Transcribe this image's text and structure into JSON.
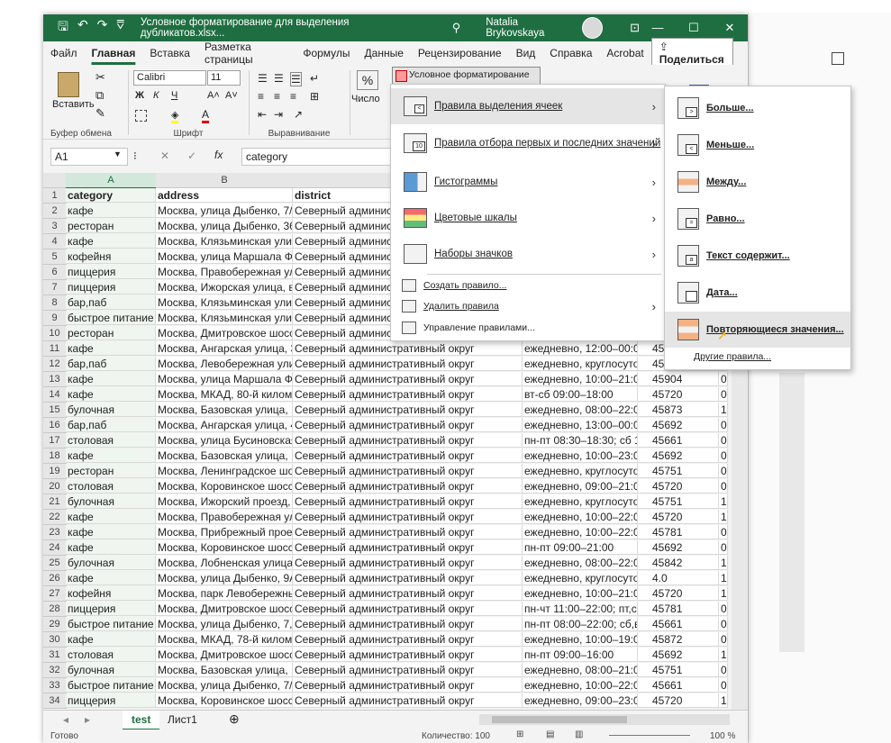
{
  "window": {
    "title": "Условное форматирование для выделения дубликатов.xlsx...",
    "user": "Natalia Brykovskaya"
  },
  "menu": {
    "items": [
      "Файл",
      "Главная",
      "Вставка",
      "Разметка страницы",
      "Формулы",
      "Данные",
      "Рецензирование",
      "Вид",
      "Справка",
      "Acrobat"
    ],
    "share": "Поделиться"
  },
  "ribbon": {
    "paste": "Вставить",
    "clipboard": "Буфер обмена",
    "font_name": "Calibri",
    "font_size": "11",
    "font_group": "Шрифт",
    "align_group": "Выравнивание",
    "number_label": "Число",
    "cond_format": "Условное форматирование"
  },
  "formula_bar": {
    "cell_ref": "A1",
    "content": "category"
  },
  "columns": [
    "A",
    "B"
  ],
  "table": {
    "rows": [
      {
        "n": "1",
        "a": "category",
        "b": "address",
        "c": "district",
        "d": "",
        "e": "",
        "f": ""
      },
      {
        "n": "2",
        "a": "кафе",
        "b": "Москва, улица Дыбенко, 7/",
        "c": "Северный администр",
        "d": "",
        "e": "",
        "f": ""
      },
      {
        "n": "3",
        "a": "ресторан",
        "b": "Москва, улица Дыбенко, 36",
        "c": "Северный администр",
        "d": "",
        "e": "",
        "f": ""
      },
      {
        "n": "4",
        "a": "кафе",
        "b": "Москва, Клязьминская улиц",
        "c": "Северный администр",
        "d": "",
        "e": "",
        "f": ""
      },
      {
        "n": "5",
        "a": "кофейня",
        "b": "Москва, улица Маршала Фе",
        "c": "Северный администр",
        "d": "",
        "e": "",
        "f": ""
      },
      {
        "n": "6",
        "a": "пиццерия",
        "b": "Москва, Правобережная ул",
        "c": "Северный администр",
        "d": "",
        "e": "",
        "f": ""
      },
      {
        "n": "7",
        "a": "пиццерия",
        "b": "Москва, Ижорская улица, в",
        "c": "Северный администр",
        "d": "",
        "e": "",
        "f": ""
      },
      {
        "n": "8",
        "a": "бар,паб",
        "b": "Москва, Клязьминская улиц",
        "c": "Северный администр",
        "d": "",
        "e": "",
        "f": ""
      },
      {
        "n": "9",
        "a": "быстрое питание",
        "b": "Москва, Клязьминская улиц",
        "c": "Северный администр",
        "d": "",
        "e": "",
        "f": ""
      },
      {
        "n": "10",
        "a": "ресторан",
        "b": "Москва, Дмитровское шоссе",
        "c": "Северный администр",
        "d": "",
        "e": "",
        "f": ""
      },
      {
        "n": "11",
        "a": "кафе",
        "b": "Москва, Ангарская улица, 3",
        "c": "Северный административный округ",
        "d": "ежедневно, 12:00–00:00",
        "e": "45",
        "f": ""
      },
      {
        "n": "12",
        "a": "бар,паб",
        "b": "Москва, Левобережная ули",
        "c": "Северный административный округ",
        "d": "ежедневно, круглосуто",
        "e": "45",
        "f": ""
      },
      {
        "n": "13",
        "a": "кафе",
        "b": "Москва, улица Маршала Фе",
        "c": "Северный административный округ",
        "d": "ежедневно, 10:00–21:00",
        "e": "45904",
        "f": "0"
      },
      {
        "n": "14",
        "a": "кафе",
        "b": "Москва, МКАД, 80-й километ",
        "c": "Северный административный округ",
        "d": "вт-сб 09:00–18:00",
        "e": "45720",
        "f": "0"
      },
      {
        "n": "15",
        "a": "булочная",
        "b": "Москва, Базовская улица, 1",
        "c": "Северный административный округ",
        "d": "ежедневно, 08:00–22:00",
        "e": "45873",
        "f": "1"
      },
      {
        "n": "16",
        "a": "бар,паб",
        "b": "Москва, Ангарская улица, 4",
        "c": "Северный административный округ",
        "d": "ежедневно, 13:00–00:00",
        "e": "45692",
        "f": "0"
      },
      {
        "n": "17",
        "a": "столовая",
        "b": "Москва, улица Бусиновская",
        "c": "Северный административный округ",
        "d": "пн-пт 08:30–18:30; сб 10",
        "e": "45661",
        "f": "0"
      },
      {
        "n": "18",
        "a": "кафе",
        "b": "Москва, Базовская улица, 1",
        "c": "Северный административный округ",
        "d": "ежедневно, 10:00–23:00",
        "e": "45692",
        "f": "0"
      },
      {
        "n": "19",
        "a": "ресторан",
        "b": "Москва, Ленинградское шо",
        "c": "Северный административный округ",
        "d": "ежедневно, круглосуто",
        "e": "45751",
        "f": "0"
      },
      {
        "n": "20",
        "a": "столовая",
        "b": "Москва, Коровинское шосс",
        "c": "Северный административный округ",
        "d": "ежедневно, 09:00–21:00",
        "e": "45720",
        "f": "0"
      },
      {
        "n": "21",
        "a": "булочная",
        "b": "Москва, Ижорский проезд,",
        "c": "Северный административный округ",
        "d": "ежедневно, круглосуто",
        "e": "45751",
        "f": "1"
      },
      {
        "n": "22",
        "a": "кафе",
        "b": "Москва, Правобережная ул",
        "c": "Северный административный округ",
        "d": "ежедневно, 10:00–22:00",
        "e": "45720",
        "f": "1"
      },
      {
        "n": "23",
        "a": "кафе",
        "b": "Москва, Прибрежный прое",
        "c": "Северный административный округ",
        "d": "ежедневно, 10:00–22:00",
        "e": "45781",
        "f": "0"
      },
      {
        "n": "24",
        "a": "кафе",
        "b": "Москва, Коровинское шосс",
        "c": "Северный административный округ",
        "d": "пн-пт 09:00–21:00",
        "e": "45692",
        "f": "0"
      },
      {
        "n": "25",
        "a": "булочная",
        "b": "Москва, Лобненская улица,",
        "c": "Северный административный округ",
        "d": "ежедневно, 08:00–22:00",
        "e": "45842",
        "f": "1"
      },
      {
        "n": "26",
        "a": "кафе",
        "b": "Москва, улица Дыбенко, 9А",
        "c": "Северный административный округ",
        "d": "ежедневно, круглосуто",
        "e": "4.0",
        "f": "1"
      },
      {
        "n": "27",
        "a": "кофейня",
        "b": "Москва, парк Левобережнь",
        "c": "Северный административный округ",
        "d": "ежедневно, 10:00–21:00",
        "e": "45720",
        "f": "1"
      },
      {
        "n": "28",
        "a": "пиццерия",
        "b": "Москва, Дмитровское шосс",
        "c": "Северный административный округ",
        "d": "пн-чт 11:00–22:00; пт,сб",
        "e": "45781",
        "f": "0"
      },
      {
        "n": "29",
        "a": "быстрое питание",
        "b": "Москва, улица Дыбенко, 7,",
        "c": "Северный административный округ",
        "d": "пн-пт 08:00–22:00; сб,вс",
        "e": "45661",
        "f": "0"
      },
      {
        "n": "30",
        "a": "кафе",
        "b": "Москва, МКАД, 78-й километ",
        "c": "Северный административный округ",
        "d": "ежедневно, 10:00–19:00",
        "e": "45872",
        "f": "0"
      },
      {
        "n": "31",
        "a": "столовая",
        "b": "Москва, Дмитровское шосс",
        "c": "Северный административный округ",
        "d": "пн-пт 09:00–16:00",
        "e": "45692",
        "f": "1"
      },
      {
        "n": "32",
        "a": "булочная",
        "b": "Москва, Базовская улица, 1",
        "c": "Северный административный округ",
        "d": "ежедневно, 08:00–21:00",
        "e": "45751",
        "f": "0"
      },
      {
        "n": "33",
        "a": "быстрое питание",
        "b": "Москва, улица Дыбенко, 7/",
        "c": "Северный административный округ",
        "d": "ежедневно, 10:00–22:00",
        "e": "45661",
        "f": "0"
      },
      {
        "n": "34",
        "a": "пиццерия",
        "b": "Москва, Коровинское шосс",
        "c": "Северный административный округ",
        "d": "ежедневно, 09:00–23:00",
        "e": "45720",
        "f": "1"
      }
    ]
  },
  "sheet_tabs": [
    "test",
    "Лист1"
  ],
  "status": {
    "ready": "Готово",
    "count": "Количество: 100",
    "zoom": "100 %"
  },
  "cf_menu": {
    "items": [
      "Правила выделения ячеек",
      "Правила отбора первых и последних значений",
      "Гистограммы",
      "Цветовые шкалы",
      "Наборы значков"
    ],
    "small_items": [
      "Создать правило...",
      "Удалить правила",
      "Управление правилами..."
    ]
  },
  "highlight_menu": {
    "items": [
      "Больше...",
      "Меньше...",
      "Между...",
      "Равно...",
      "Текст содержит...",
      "Дата...",
      "Повторяющиеся значения..."
    ],
    "more": "Другие правила..."
  }
}
